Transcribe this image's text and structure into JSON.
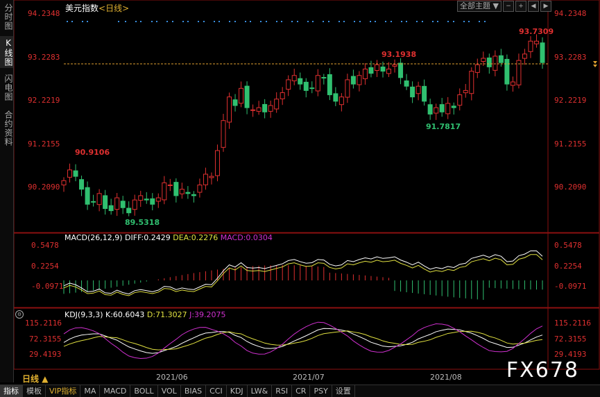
{
  "title": "美元指数",
  "period_tag": "<日线>",
  "left_tabs": [
    "分时图",
    "K线图",
    "闪电图",
    "合约资料"
  ],
  "controls": {
    "dropdown": "全部主题",
    "icons": [
      "minus-icon",
      "plus-icon",
      "left-icon",
      "right-icon"
    ]
  },
  "price_axis": [
    "94.2348",
    "93.2283",
    "92.2219",
    "91.2155",
    "90.2090"
  ],
  "current_price_line": 93.07,
  "annotations": {
    "high1": "90.9106",
    "low1": "89.5318",
    "high2": "93.1938",
    "low2": "91.7817",
    "high3": "93.7309"
  },
  "macd": {
    "header": "MACD(26,12,9)",
    "diff": "DIFF:0.2429",
    "dea": "DEA:0.2276",
    "macd": "MACD:0.0304",
    "axis": [
      "0.5478",
      "0.2254",
      "-0.0971"
    ]
  },
  "kdj": {
    "header": "KDJ(9,3,3)",
    "k": "K:60.6043",
    "d": "D:71.3027",
    "j": "J:39.2075",
    "axis": [
      "115.2116",
      "72.3155",
      "29.4193"
    ]
  },
  "x_axis": [
    "2021/06",
    "2021/07",
    "2021/08"
  ],
  "period_label": "日线",
  "bottom_tabs": [
    "指标",
    "模板",
    "VIP指标",
    "MA",
    "MACD",
    "BOLL",
    "VOL",
    "BIAS",
    "CCI",
    "KDJ",
    "LW&",
    "RSI",
    "CR",
    "PSY",
    "设置"
  ],
  "watermark": "FX678",
  "colors": {
    "up": "#e03030",
    "down": "#30c070",
    "diff": "#ffffff",
    "dea": "#e0e040",
    "k": "#ffffff",
    "d": "#e0e040",
    "j": "#d030d0"
  }
}
